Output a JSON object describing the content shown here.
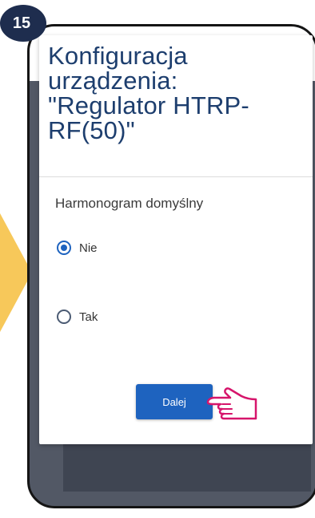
{
  "step": {
    "number": "15"
  },
  "colors": {
    "accent": "#1e63bf",
    "title": "#1d3e6e",
    "arrow": "#f7c85a",
    "hand": "#d6156b",
    "badge": "#1e2d4e"
  },
  "dialog": {
    "title": "Konfiguracja urządzenia: \"Regulator HTRP-RF(50)\"",
    "section_label": "Harmonogram domyślny",
    "options": [
      {
        "label": "Nie",
        "selected": true
      },
      {
        "label": "Tak",
        "selected": false
      }
    ],
    "next_button": "Dalej"
  },
  "icons": {
    "pointer": "pointing-hand-icon",
    "arrow": "arrow-right-icon"
  }
}
